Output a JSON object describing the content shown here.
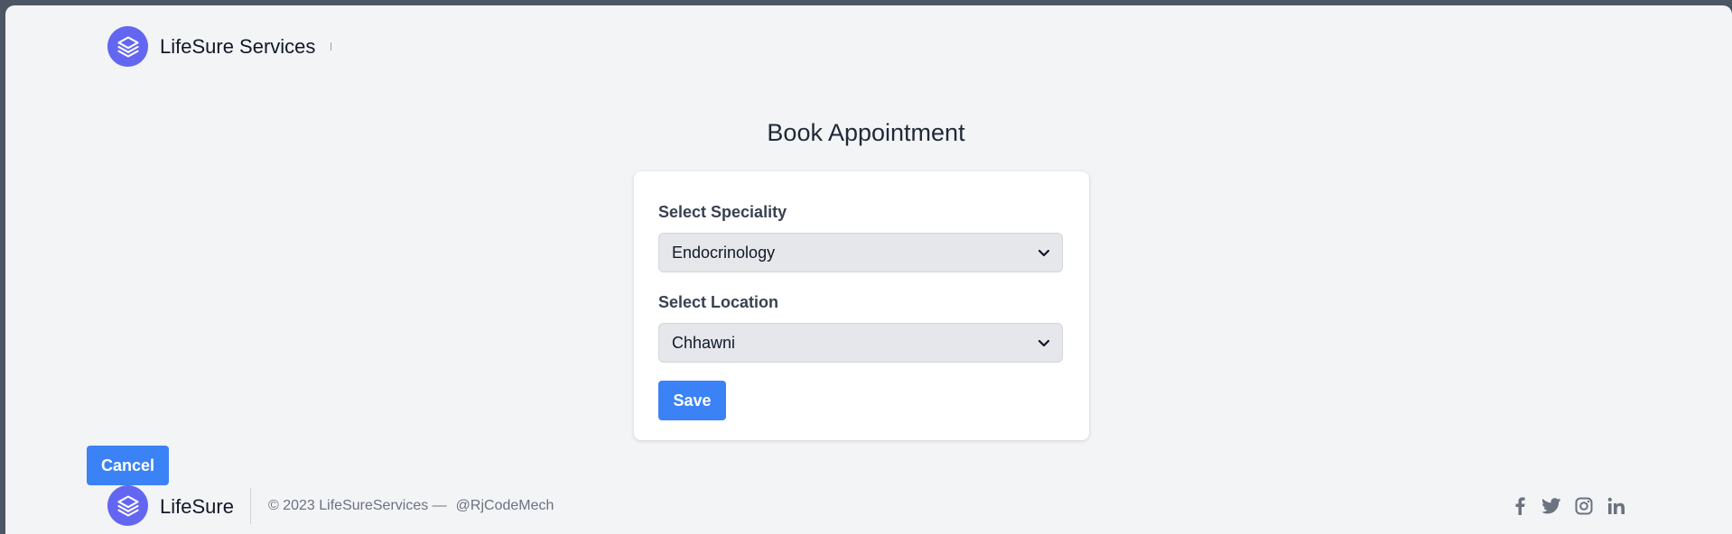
{
  "header": {
    "brand": "LifeSure Services"
  },
  "main": {
    "title": "Book Appointment",
    "speciality": {
      "label": "Select Speciality",
      "value": "Endocrinology"
    },
    "location": {
      "label": "Select Location",
      "value": "Chhawni"
    },
    "save_label": "Save"
  },
  "cancel_label": "Cancel",
  "footer": {
    "brand": "LifeSure",
    "copyright": "© 2023 LifeSureServices —",
    "handle": "@RjCodeMech",
    "social": [
      "facebook-icon",
      "twitter-icon",
      "instagram-icon",
      "linkedin-icon"
    ]
  },
  "colors": {
    "accent": "#3b82f6",
    "logo": "#6366f1",
    "background": "#f3f4f6"
  }
}
